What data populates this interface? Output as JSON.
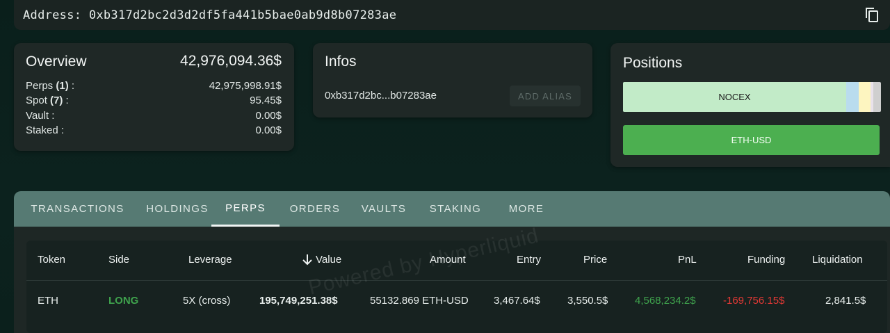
{
  "address_bar": {
    "label": "Address: 0xb317d2bc2d3d2df5fa441b5bae0ab9d8b07283ae",
    "copy_icon": "copy-icon"
  },
  "overview": {
    "title": "Overview",
    "total": "42,976,094.36$",
    "rows": [
      {
        "label": "Perps ",
        "count": "(1)",
        "suffix": " :",
        "value": "42,975,998.91$"
      },
      {
        "label": "Spot ",
        "count": "(7)",
        "suffix": " :",
        "value": "95.45$"
      },
      {
        "label": "Vault :",
        "count": "",
        "suffix": "",
        "value": "0.00$"
      },
      {
        "label": "Staked :",
        "count": "",
        "suffix": "",
        "value": "0.00$"
      }
    ]
  },
  "infos": {
    "title": "Infos",
    "address_short": "0xb317d2bc...b07283ae",
    "add_alias": "ADD ALIAS"
  },
  "positions": {
    "title": "Positions",
    "bar_main_label": "NOCEX",
    "segment_colors": [
      "#c2ebc8",
      "#b9dcee",
      "#fdf5c0",
      "#e9e2ea",
      "#cfcfcf"
    ],
    "button_label": "ETH-USD",
    "button_color": "#4caf50"
  },
  "tabs": [
    "TRANSACTIONS",
    "HOLDINGS",
    "PERPS",
    "ORDERS",
    "VAULTS",
    "STAKING",
    "MORE"
  ],
  "active_tab": "PERPS",
  "table": {
    "headers": [
      "Token",
      "Side",
      "Leverage",
      "Value",
      "Amount",
      "Entry",
      "Price",
      "PnL",
      "Funding",
      "Liquidation"
    ],
    "sort_icon": "arrow-down-icon",
    "rows": [
      {
        "token": "ETH",
        "side": "LONG",
        "leverage": "5X (cross)",
        "value": "195,749,251.38$",
        "amount": "55132.869 ETH-USD",
        "entry": "3,467.64$",
        "price": "3,550.5$",
        "pnl": "4,568,234.2$",
        "funding": "-169,756.15$",
        "liquidation": "2,841.5$"
      }
    ]
  },
  "colors": {
    "long": "#3fa34d",
    "pnl_positive": "#3fa34d",
    "funding_negative": "#e53935",
    "accent": "#567a73"
  },
  "watermark": "Powered by Hyperliquid"
}
